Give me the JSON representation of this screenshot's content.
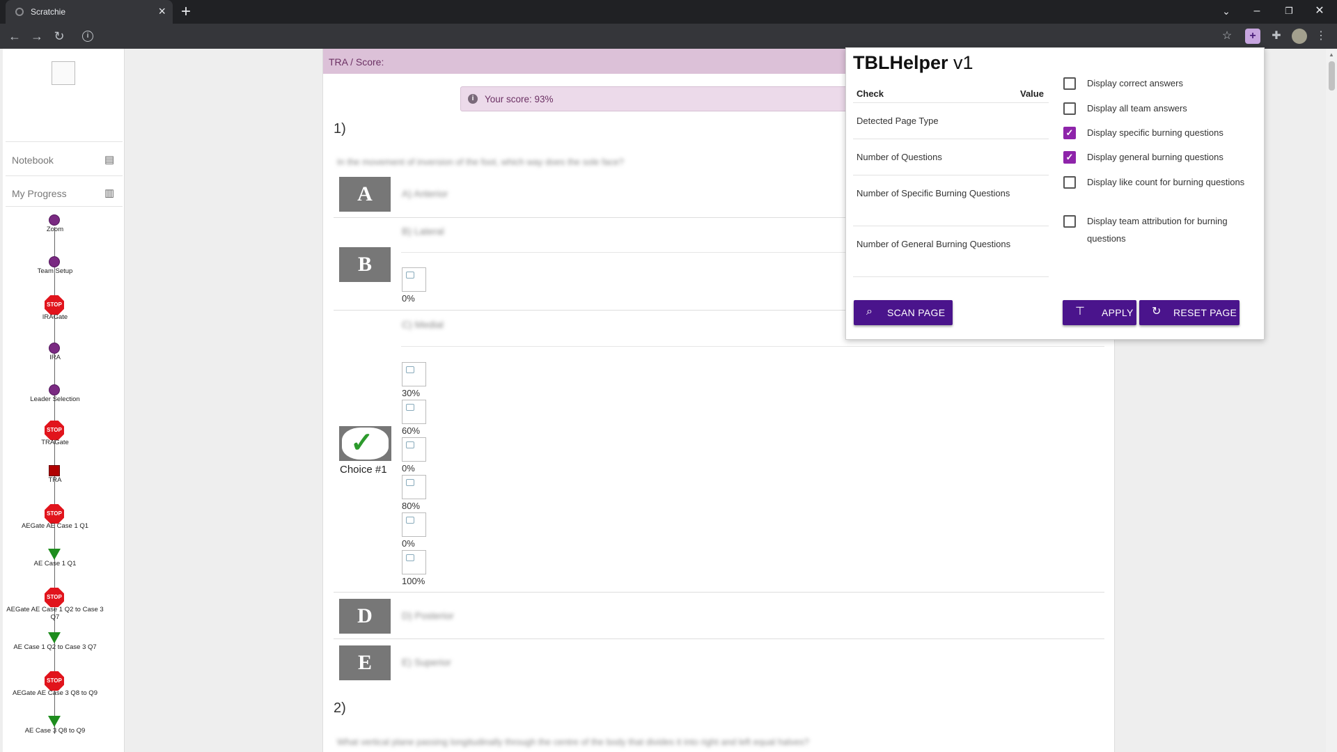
{
  "browser": {
    "tab_title": "Scratchie",
    "tab_close": "×",
    "new_tab": "+",
    "controls": {
      "minimize": "–",
      "restore": "❐",
      "close": "✕"
    },
    "nav": {
      "back": "←",
      "forward": "→",
      "reload": "↻"
    },
    "icons": [
      "star-icon",
      "extension-active-icon",
      "puzzle-icon",
      "avatar-icon",
      "menu-icon"
    ]
  },
  "sidebar": {
    "notebook": "Notebook",
    "my_progress": "My Progress",
    "timeline": [
      {
        "type": "dot",
        "label": "Zoom"
      },
      {
        "type": "dot",
        "label": "Team Setup"
      },
      {
        "type": "stop",
        "label": "IRAGate"
      },
      {
        "type": "dot",
        "label": "IRA"
      },
      {
        "type": "dot",
        "label": "Leader Selection"
      },
      {
        "type": "stop",
        "label": "TRAGate"
      },
      {
        "type": "square",
        "label": "TRA"
      },
      {
        "type": "stop",
        "label": "AEGate AE Case 1 Q1"
      },
      {
        "type": "tri",
        "label": "AE Case 1 Q1"
      },
      {
        "type": "stop",
        "label": "AEGate AE Case 1 Q2 to Case 3 Q7"
      },
      {
        "type": "tri",
        "label": "AE Case 1 Q2 to Case 3 Q7"
      },
      {
        "type": "stop",
        "label": "AEGate AE Case 3 Q8 to Q9"
      },
      {
        "type": "tri",
        "label": "AE Case 3 Q8 to Q9"
      }
    ],
    "stop_text": "STOP"
  },
  "main": {
    "header": "TRA / Score:",
    "score_text": "Your score: 93%",
    "q1_number": "1)",
    "q1_text": "In the movement of inversion of the foot, which way does the sole face?",
    "options": {
      "a_letter": "A",
      "a_text": "A) Anterior",
      "b_letter": "B",
      "b_text": "B) Lateral",
      "b_pct": "0%",
      "c_text": "C) Medial",
      "c_pcts": [
        "30%",
        "60%",
        "0%",
        "80%",
        "0%",
        "100%"
      ],
      "choice_label": "Choice #1",
      "d_letter": "D",
      "d_text": "D) Posterior",
      "e_letter": "E",
      "e_text": "E) Superior"
    },
    "q2_number": "2)",
    "q2_text": "What vertical plane passing longitudinally through the centre of the body that divides it into right and left equal halves?"
  },
  "popup": {
    "title": "TBLHelper",
    "version": "v1",
    "col_check": "Check",
    "col_value": "Value",
    "rows": [
      "Detected Page Type",
      "Number of Questions",
      "Number of Specific Burning Questions",
      "Number of General Burning Questions"
    ],
    "options": [
      {
        "label": "Display correct answers",
        "checked": false
      },
      {
        "label": "Display all team answers",
        "checked": false
      },
      {
        "label": "Display specific burning questions",
        "checked": true
      },
      {
        "label": "Display general burning questions",
        "checked": true
      },
      {
        "label": "Display like count for burning questions",
        "checked": false
      },
      {
        "label": "Display team attribution for burning questions",
        "checked": false
      }
    ],
    "scan_button": "SCAN PAGE",
    "apply_button": "APPLY",
    "reset_button": "RESET PAGE",
    "accent": "#4a148c"
  }
}
